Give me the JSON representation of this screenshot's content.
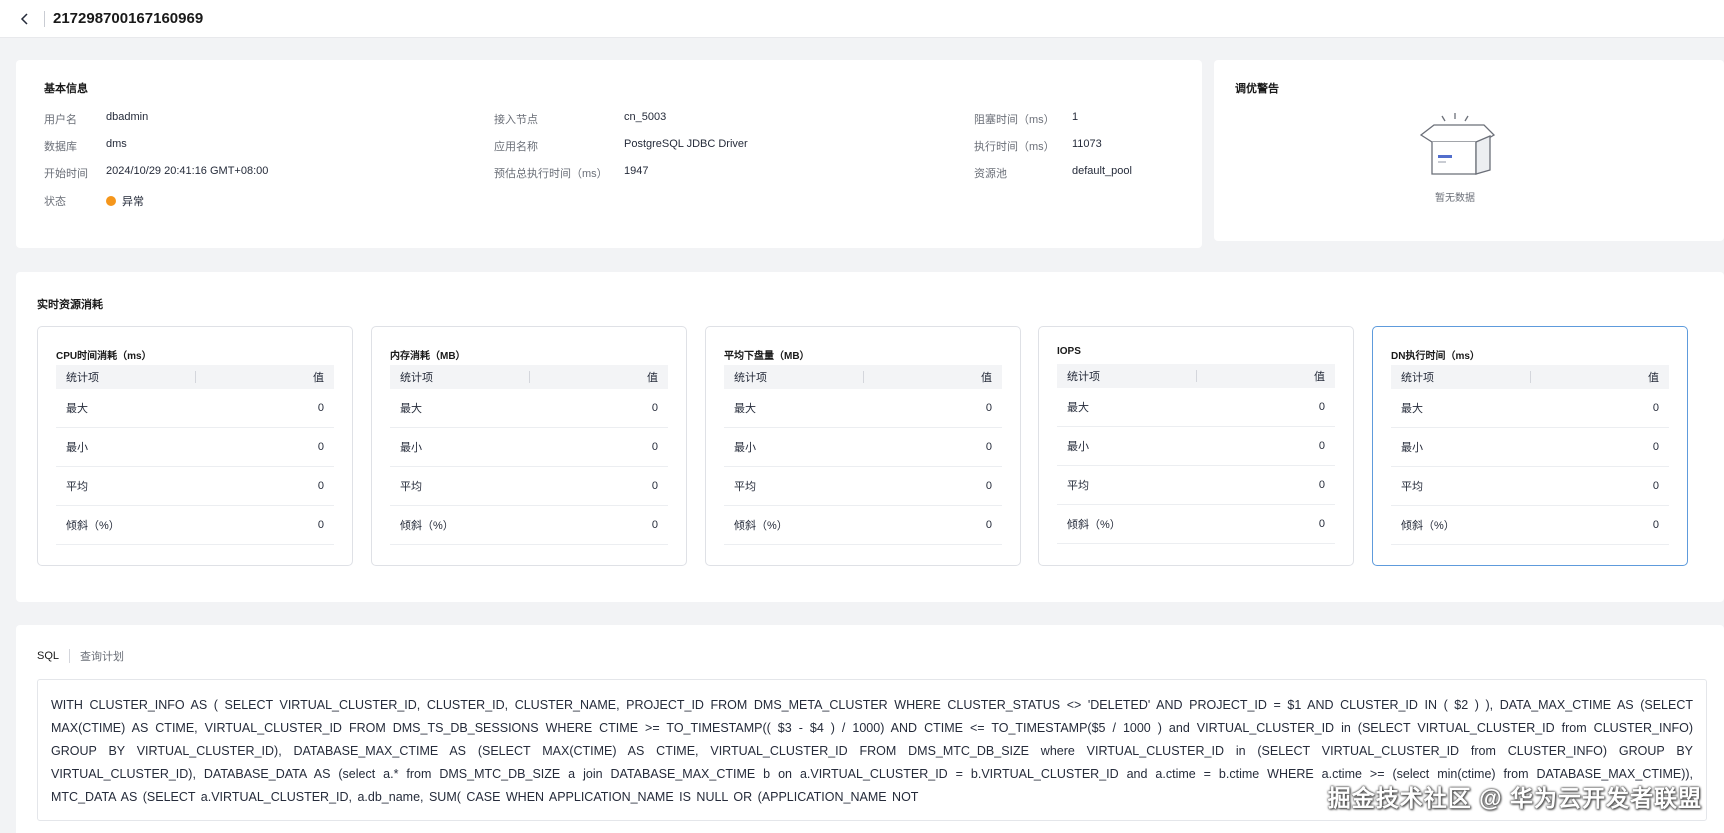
{
  "header": {
    "title": "217298700167160969"
  },
  "basic": {
    "title": "基本信息",
    "col1": [
      {
        "label": "用户名",
        "value": "dbadmin"
      },
      {
        "label": "数据库",
        "value": "dms"
      },
      {
        "label": "开始时间",
        "value": "2024/10/29 20:41:16 GMT+08:00"
      },
      {
        "label": "状态",
        "value": "异常"
      }
    ],
    "col2": [
      {
        "label": "接入节点",
        "value": "cn_5003"
      },
      {
        "label": "应用名称",
        "value": "PostgreSQL JDBC Driver"
      },
      {
        "label": "预估总执行时间（ms）",
        "value": "1947"
      }
    ],
    "col3": [
      {
        "label": "阻塞时间（ms）",
        "value": "1"
      },
      {
        "label": "执行时间（ms）",
        "value": "11073"
      },
      {
        "label": "资源池",
        "value": "default_pool"
      }
    ],
    "status_color": "#f5961b"
  },
  "tuning": {
    "title": "调优警告",
    "empty_text": "暂无数据"
  },
  "realtime": {
    "title": "实时资源消耗",
    "col_stat": "统计项",
    "col_value": "值",
    "rows": [
      "最大",
      "最小",
      "平均",
      "倾斜（%）"
    ],
    "metrics": [
      {
        "title": "CPU时间消耗（ms）",
        "values": [
          "0",
          "0",
          "0",
          "0"
        ]
      },
      {
        "title": "内存消耗（MB）",
        "values": [
          "0",
          "0",
          "0",
          "0"
        ]
      },
      {
        "title": "平均下盘量（MB）",
        "values": [
          "0",
          "0",
          "0",
          "0"
        ]
      },
      {
        "title": "IOPS",
        "values": [
          "0",
          "0",
          "0",
          "0"
        ]
      },
      {
        "title": "DN执行时间（ms）",
        "values": [
          "0",
          "0",
          "0",
          "0"
        ]
      }
    ]
  },
  "sql": {
    "tabs": [
      "SQL",
      "查询计划"
    ],
    "text": "WITH CLUSTER_INFO AS ( SELECT VIRTUAL_CLUSTER_ID, CLUSTER_ID, CLUSTER_NAME, PROJECT_ID FROM DMS_META_CLUSTER WHERE CLUSTER_STATUS <> 'DELETED' AND PROJECT_ID = $1 AND CLUSTER_ID IN ( $2 ) ), DATA_MAX_CTIME AS (SELECT MAX(CTIME) AS CTIME, VIRTUAL_CLUSTER_ID FROM DMS_TS_DB_SESSIONS WHERE CTIME >= TO_TIMESTAMP(( $3 - $4 ) / 1000) AND CTIME <= TO_TIMESTAMP($5 / 1000 ) and VIRTUAL_CLUSTER_ID in (SELECT VIRTUAL_CLUSTER_ID from CLUSTER_INFO) GROUP BY VIRTUAL_CLUSTER_ID), DATABASE_MAX_CTIME AS (SELECT MAX(CTIME) AS CTIME, VIRTUAL_CLUSTER_ID FROM DMS_MTC_DB_SIZE where VIRTUAL_CLUSTER_ID in (SELECT VIRTUAL_CLUSTER_ID from CLUSTER_INFO) GROUP BY VIRTUAL_CLUSTER_ID), DATABASE_DATA AS (select a.* from DMS_MTC_DB_SIZE a join DATABASE_MAX_CTIME b on a.VIRTUAL_CLUSTER_ID = b.VIRTUAL_CLUSTER_ID and a.ctime = b.ctime WHERE a.ctime >= (select min(ctime) from DATABASE_MAX_CTIME)), MTC_DATA AS (SELECT a.VIRTUAL_CLUSTER_ID, a.db_name, SUM( CASE WHEN APPLICATION_NAME IS NULL OR (APPLICATION_NAME NOT"
  },
  "watermark": "掘金技术社区 @ 华为云开发者联盟"
}
